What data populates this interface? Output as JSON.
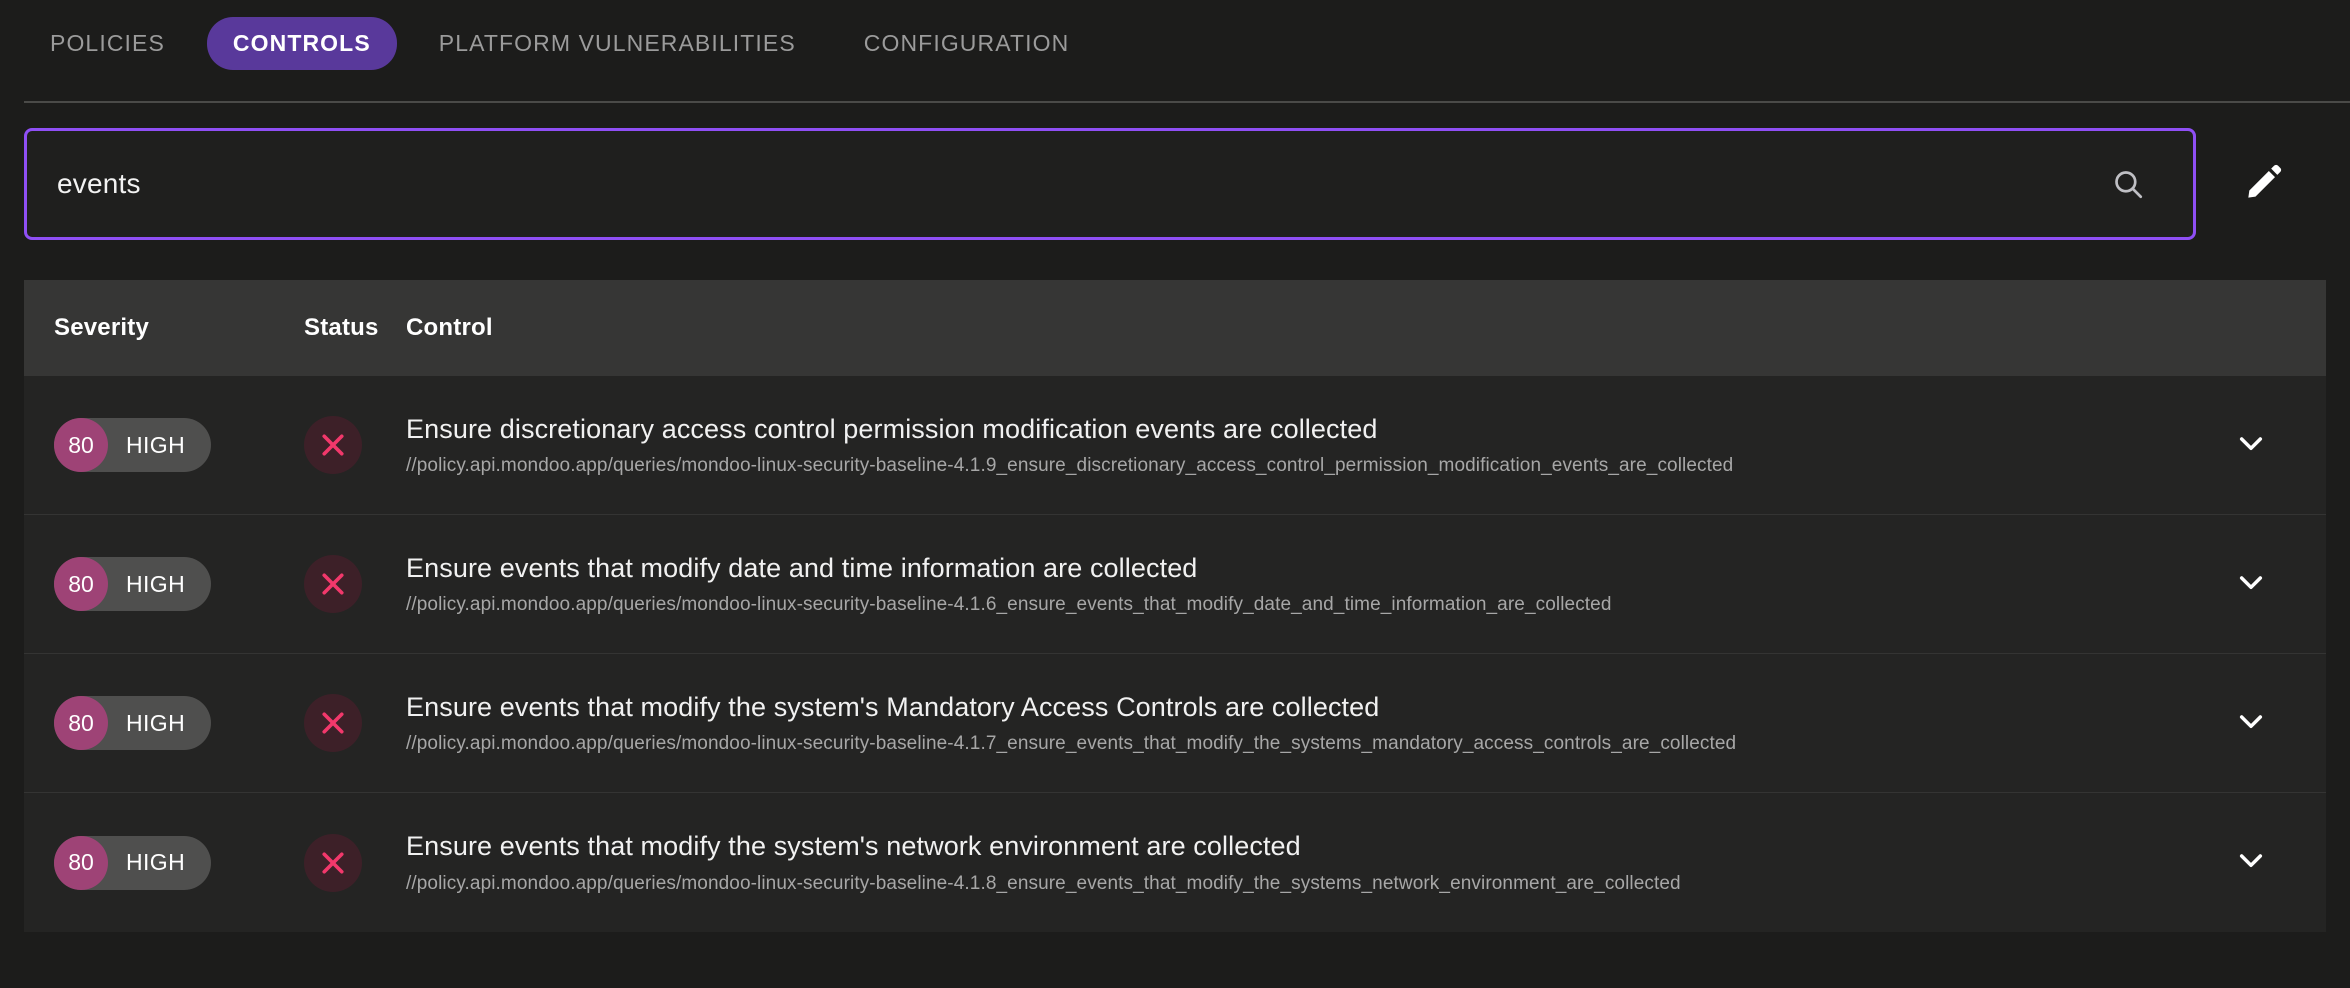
{
  "tabs": [
    {
      "label": "POLICIES",
      "active": false
    },
    {
      "label": "CONTROLS",
      "active": true
    },
    {
      "label": "PLATFORM VULNERABILITIES",
      "active": false
    },
    {
      "label": "CONFIGURATION",
      "active": false
    }
  ],
  "search": {
    "value": "events",
    "placeholder": "Search",
    "search_icon": "search-icon",
    "edit_icon": "pencil-icon"
  },
  "table": {
    "headers": {
      "severity": "Severity",
      "status": "Status",
      "control": "Control"
    },
    "rows": [
      {
        "severity_score": "80",
        "severity_label": "HIGH",
        "status_icon": "fail-x-icon",
        "title": "Ensure discretionary access control permission modification events are collected",
        "url": "//policy.api.mondoo.app/queries/mondoo-linux-security-baseline-4.1.9_ensure_discretionary_access_control_permission_modification_events_are_collected",
        "expand_icon": "chevron-down-icon"
      },
      {
        "severity_score": "80",
        "severity_label": "HIGH",
        "status_icon": "fail-x-icon",
        "title": "Ensure events that modify date and time information are collected",
        "url": "//policy.api.mondoo.app/queries/mondoo-linux-security-baseline-4.1.6_ensure_events_that_modify_date_and_time_information_are_collected",
        "expand_icon": "chevron-down-icon"
      },
      {
        "severity_score": "80",
        "severity_label": "HIGH",
        "status_icon": "fail-x-icon",
        "title": "Ensure events that modify the system's Mandatory Access Controls are collected",
        "url": "//policy.api.mondoo.app/queries/mondoo-linux-security-baseline-4.1.7_ensure_events_that_modify_the_systems_mandatory_access_controls_are_collected",
        "expand_icon": "chevron-down-icon"
      },
      {
        "severity_score": "80",
        "severity_label": "HIGH",
        "status_icon": "fail-x-icon",
        "title": "Ensure events that modify the system's network environment are collected",
        "url": "//policy.api.mondoo.app/queries/mondoo-linux-security-baseline-4.1.8_ensure_events_that_modify_the_systems_network_environment_are_collected",
        "expand_icon": "chevron-down-icon"
      }
    ]
  },
  "colors": {
    "page_background": "#1c1c1b",
    "table_background": "#242423",
    "header_background": "#363635",
    "accent_purple": "#8f4ff5",
    "active_tab_purple": "#59399b",
    "severity_magenta": "#9e4376",
    "fail_pink": "#f2386b",
    "fail_circle": "#3d2028"
  }
}
